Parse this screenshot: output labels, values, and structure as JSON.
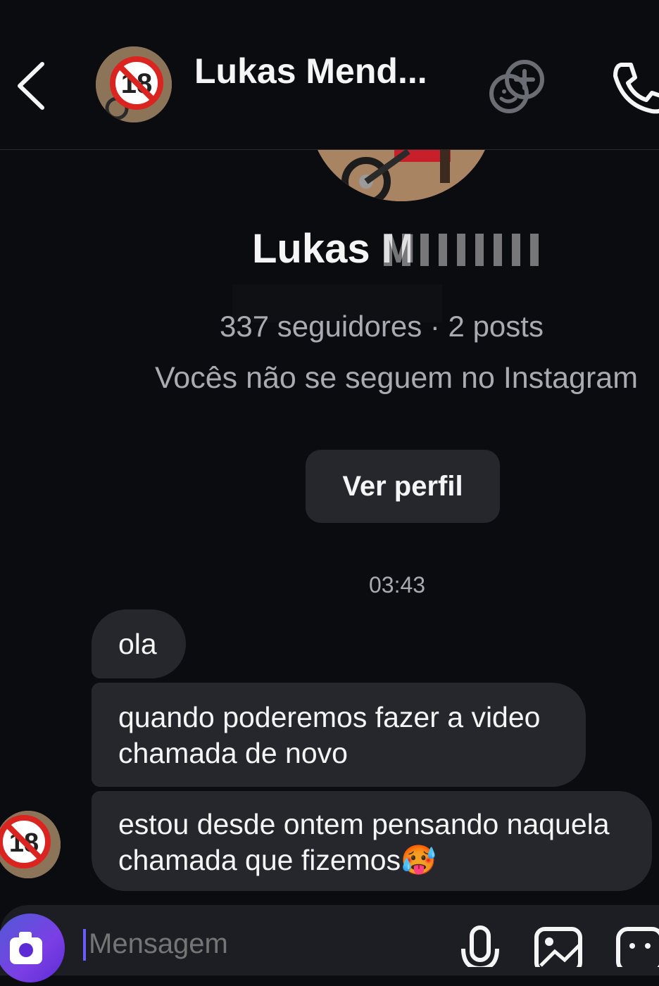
{
  "header": {
    "contact_name": "Lukas Mend...",
    "back_icon": "chevron-left-icon",
    "effects_icon": "add-effects-icon",
    "call_icon": "phone-icon"
  },
  "profile": {
    "name": "Lukas M",
    "stats": "337 seguidores · 2 posts",
    "follow_note": "Vocês não se seguem no Instagram",
    "view_profile_label": "Ver perfil"
  },
  "conversation": {
    "timestamp": "03:43",
    "messages": [
      {
        "text": "ola"
      },
      {
        "line1": "quando poderemos fazer a video",
        "line2": "chamada de novo"
      },
      {
        "line1": "estou desde ontem pensando naquela",
        "line2": "chamada que fizemos",
        "emoji": "🥵"
      }
    ]
  },
  "composer": {
    "placeholder": "Mensagem",
    "icons": [
      "camera-icon",
      "microphone-icon",
      "gallery-icon",
      "sticker-icon"
    ]
  },
  "colors": {
    "background": "#0b0c10",
    "bubble": "#26272c",
    "secondary_text": "#a9abb3",
    "accent": "#5c2bd6"
  }
}
